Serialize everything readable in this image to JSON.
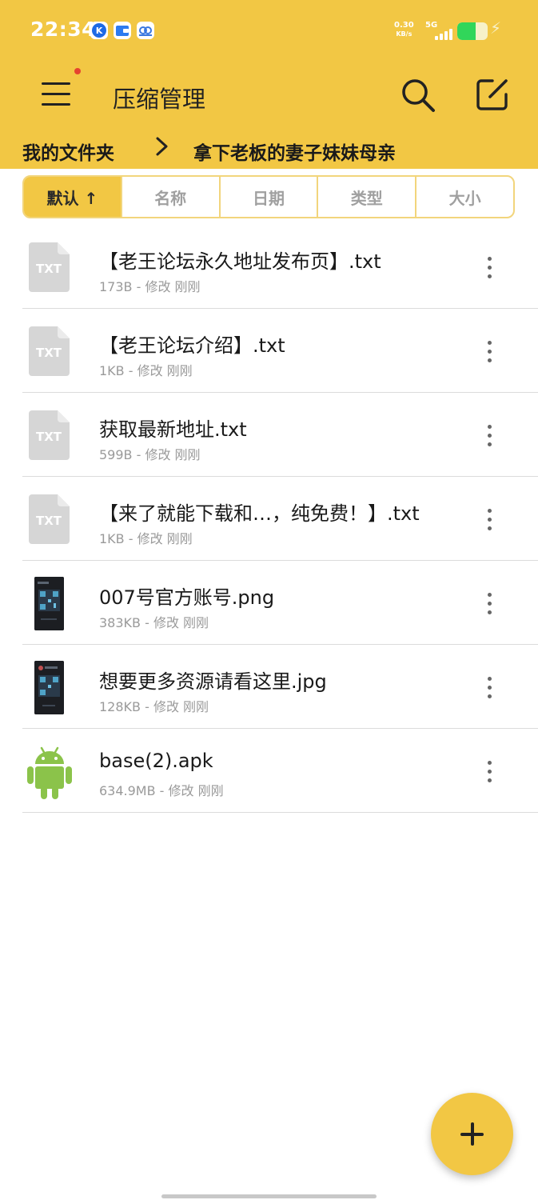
{
  "status_bar": {
    "time": "22:34",
    "net_speed_value": "0.30",
    "net_speed_unit": "KB/s",
    "network": "5G",
    "battery_level": 0.6,
    "notification_icons": [
      "k-app-icon",
      "wallet-icon",
      "cloud-app-icon"
    ]
  },
  "toolbar": {
    "title": "压缩管理",
    "menu_icon": "hamburger-menu-icon",
    "search_icon": "search-icon",
    "edit_icon": "edit-icon"
  },
  "breadcrumb": {
    "root": "我的文件夹",
    "current": "拿下老板的妻子妹妹母亲"
  },
  "sort_tabs": [
    {
      "label": "默认 ↑",
      "active": true
    },
    {
      "label": "名称",
      "active": false
    },
    {
      "label": "日期",
      "active": false
    },
    {
      "label": "类型",
      "active": false
    },
    {
      "label": "大小",
      "active": false
    }
  ],
  "files": [
    {
      "name": "【老王论坛永久地址发布页】.txt",
      "meta": "173B - 修改 刚刚",
      "icon": "txt-file-icon"
    },
    {
      "name": "【老王论坛介绍】.txt",
      "meta": "1KB - 修改 刚刚",
      "icon": "txt-file-icon"
    },
    {
      "name": "获取最新地址.txt",
      "meta": "599B - 修改 刚刚",
      "icon": "txt-file-icon"
    },
    {
      "name": "【来了就能下载和…，纯免费！】.txt",
      "meta": "1KB - 修改 刚刚",
      "icon": "txt-file-icon"
    },
    {
      "name": "007号官方账号.png",
      "meta": "383KB - 修改 刚刚",
      "icon": "image-thumbnail"
    },
    {
      "name": "想要更多资源请看这里.jpg",
      "meta": "128KB - 修改 刚刚",
      "icon": "image-thumbnail"
    },
    {
      "name": "base(2).apk",
      "meta": "634.9MB - 修改 刚刚",
      "icon": "android-icon"
    }
  ],
  "fab": {
    "icon": "plus-icon"
  },
  "colors": {
    "accent": "#f2c744",
    "text": "#1a1a1a",
    "meta": "#9a9a9a",
    "android": "#8bc34a"
  }
}
